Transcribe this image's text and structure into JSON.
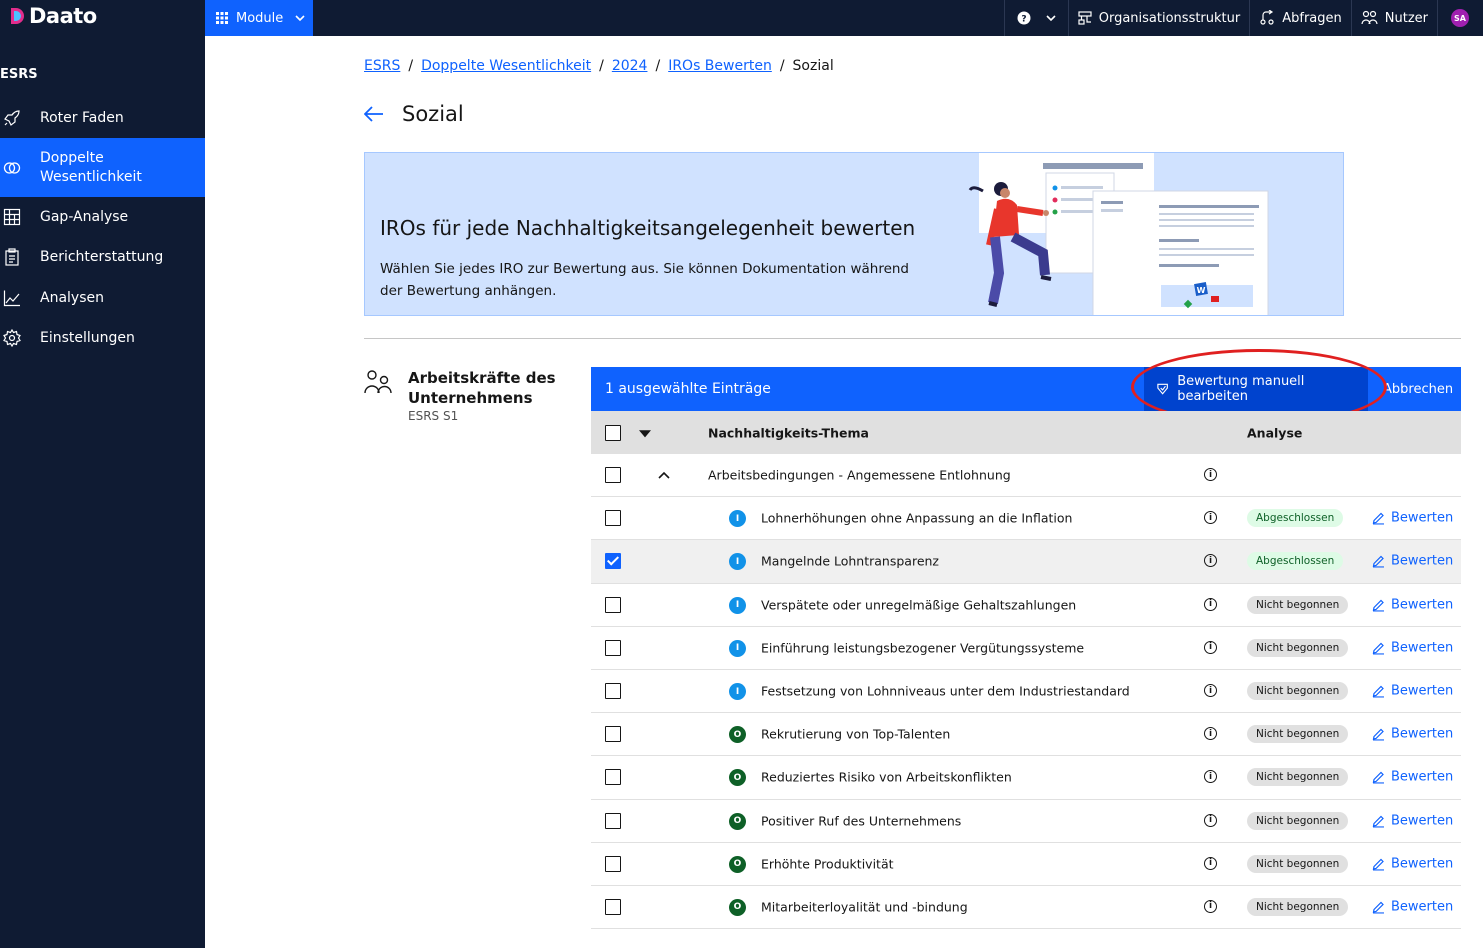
{
  "app": {
    "name": "Daato"
  },
  "topbar": {
    "module_label": "Module",
    "help_icon": "help-icon",
    "items": [
      {
        "label": "Organisationsstruktur",
        "icon": "org-structure-icon"
      },
      {
        "label": "Abfragen",
        "icon": "queries-icon"
      },
      {
        "label": "Nutzer",
        "icon": "users-icon"
      }
    ],
    "avatar": "SA"
  },
  "sidebar": {
    "section": "ESRS",
    "items": [
      {
        "label": "Roter Faden",
        "icon": "rocket-icon"
      },
      {
        "label": "Doppelte\nWesentlichkeit",
        "icon": "double-materiality-icon",
        "active": true
      },
      {
        "label": "Gap-Analyse",
        "icon": "grid-icon"
      },
      {
        "label": "Berichterstattung",
        "icon": "clipboard-icon"
      },
      {
        "label": "Analysen",
        "icon": "chart-line-icon"
      },
      {
        "label": "Einstellungen",
        "icon": "settings-icon"
      }
    ]
  },
  "breadcrumb": [
    "ESRS",
    "Doppelte Wesentlichkeit",
    "2024",
    "IROs Bewerten",
    "Sozial"
  ],
  "page": {
    "title": "Sozial"
  },
  "banner": {
    "title": "IROs für jede Nachhaltigkeitsangelegenheit bewerten",
    "text": "Wählen Sie jedes IRO zur Bewertung aus. Sie können Dokumentation während der Bewertung anhängen."
  },
  "group": {
    "title": "Arbeitskräfte des Unternehmens",
    "subtitle": "ESRS S1"
  },
  "table": {
    "selection_text": "1 ausgewählte Einträge",
    "edit_button": "Bewertung manuell bearbeiten",
    "cancel_button": "Abbrechen",
    "headers": {
      "topic": "Nachhaltigkeits-Thema",
      "analysis": "Analyse"
    },
    "parent_row": "Arbeitsbedingungen - Angemessene Entlohnung",
    "action_label": "Bewerten",
    "colors": {
      "impact": "#1192e8",
      "opportunity": "#0e6027",
      "accent": "#0f62fe"
    },
    "rows": [
      {
        "type": "I",
        "label": "Lohnerhöhungen ohne Anpassung an die Inflation",
        "status": "Abgeschlossen",
        "state": "done",
        "checked": false
      },
      {
        "type": "I",
        "label": "Mangelnde Lohntransparenz",
        "status": "Abgeschlossen",
        "state": "done",
        "checked": true
      },
      {
        "type": "I",
        "label": "Verspätete oder unregelmäßige Gehaltszahlungen",
        "status": "Nicht begonnen",
        "state": "todo",
        "checked": false
      },
      {
        "type": "I",
        "label": "Einführung leistungsbezogener Vergütungssysteme",
        "status": "Nicht begonnen",
        "state": "todo",
        "checked": false
      },
      {
        "type": "I",
        "label": "Festsetzung von Lohnniveaus unter dem Industriestandard",
        "status": "Nicht begonnen",
        "state": "todo",
        "checked": false
      },
      {
        "type": "O",
        "label": "Rekrutierung von Top-Talenten",
        "status": "Nicht begonnen",
        "state": "todo",
        "checked": false
      },
      {
        "type": "O",
        "label": "Reduziertes Risiko von Arbeitskonflikten",
        "status": "Nicht begonnen",
        "state": "todo",
        "checked": false
      },
      {
        "type": "O",
        "label": "Positiver Ruf des Unternehmens",
        "status": "Nicht begonnen",
        "state": "todo",
        "checked": false
      },
      {
        "type": "O",
        "label": "Erhöhte Produktivität",
        "status": "Nicht begonnen",
        "state": "todo",
        "checked": false
      },
      {
        "type": "O",
        "label": "Mitarbeiterloyalität und -bindung",
        "status": "Nicht begonnen",
        "state": "todo",
        "checked": false
      }
    ]
  }
}
